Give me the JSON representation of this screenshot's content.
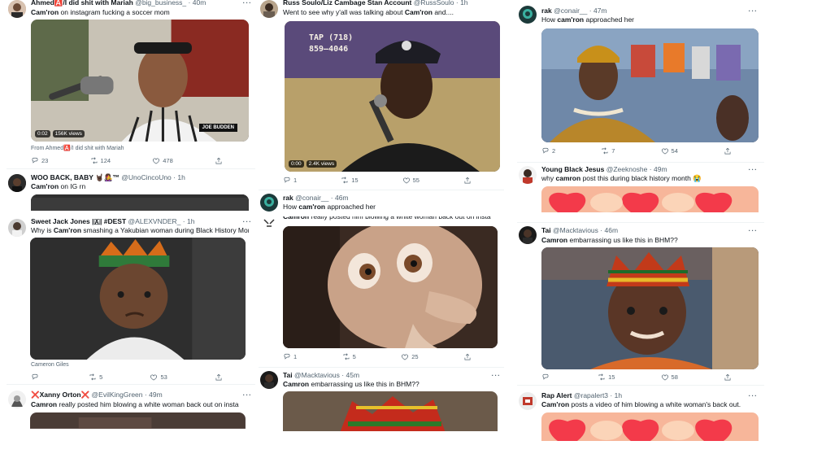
{
  "columns": [
    {
      "tweets": [
        {
          "name": "Ahmed🅰️/I did shit with Mariah",
          "handle": "@big_business_",
          "time": "40m",
          "text": [
            {
              "t": "Cam'ron",
              "b": true
            },
            {
              "t": " on instagram fucking a soccer mom",
              "b": false
            }
          ],
          "video_time": "0:02",
          "views": "156K views",
          "from_label": "From",
          "from_name": "Ahmed🅰️/I did shit with Mariah",
          "replies": "23",
          "retweets": "124",
          "likes": "478",
          "media_badge": "JOE BUDDEN"
        },
        {
          "name": "WOO BACK, BABY 🤘🏿👩‍🎤™",
          "handle": "@UnoCincoUno",
          "time": "1h",
          "text": [
            {
              "t": "Cam'ron",
              "b": true
            },
            {
              "t": " on IG rn",
              "b": false
            }
          ]
        },
        {
          "name": "Sweet Jack Jones |🇦| #DEST",
          "handle": "@ALEXVNDER_",
          "time": "1h",
          "text": [
            {
              "t": "Why is ",
              "b": false
            },
            {
              "t": "Cam'ron",
              "b": true
            },
            {
              "t": " smashing a Yakubian woman during Black History Month???",
              "b": false
            }
          ],
          "credit": "Cameron Giles",
          "replies": "",
          "retweets": "5",
          "likes": "53"
        },
        {
          "name": "❌Xanny Orton❌",
          "handle": "@EvilKingGreen",
          "time": "49m",
          "text": [
            {
              "t": "Camron",
              "b": true
            },
            {
              "t": " really posted him blowing a white woman back out on insta",
              "b": false
            }
          ]
        }
      ]
    },
    {
      "tweets": [
        {
          "name": "Russ Soulo/Liz Cambage Stan Account",
          "handle": "@RussSoulo",
          "time": "1h",
          "text": [
            {
              "t": "Went to see why y'all was talking about ",
              "b": false
            },
            {
              "t": "Cam'ron",
              "b": true
            },
            {
              "t": " and....",
              "b": false
            }
          ],
          "video_time": "0:00",
          "views": "2.4K views",
          "media_caption": "TAP (718)\n859—4046",
          "replies": "1",
          "retweets": "15",
          "likes": "55"
        },
        {
          "name": "rak",
          "handle": "@conair__",
          "time": "46m",
          "text": [
            {
              "t": "How ",
              "b": false
            },
            {
              "t": "cam'ron",
              "b": true
            },
            {
              "t": " approached her",
              "b": false
            }
          ]
        },
        {
          "cut_text": [
            {
              "t": "Camron",
              "b": true
            },
            {
              "t": " really posted him blowing a white woman back out on insta",
              "b": false
            }
          ],
          "replies": "1",
          "retweets": "5",
          "likes": "25"
        },
        {
          "name": "Tai",
          "handle": "@Macktavious",
          "time": "45m",
          "text": [
            {
              "t": "Camron",
              "b": true
            },
            {
              "t": " embarrassing us like this in BHM??",
              "b": false
            }
          ]
        }
      ]
    },
    {
      "tweets": [
        {
          "name": "rak",
          "handle": "@conair__",
          "time": "47m",
          "text": [
            {
              "t": "How ",
              "b": false
            },
            {
              "t": "cam'ron",
              "b": true
            },
            {
              "t": " approached her",
              "b": false
            }
          ],
          "replies": "2",
          "retweets": "7",
          "likes": "54"
        },
        {
          "name": "Young Black Jesus",
          "handle": "@Zeeknoshe",
          "time": "49m",
          "text": [
            {
              "t": "why ",
              "b": false
            },
            {
              "t": "camron",
              "b": true
            },
            {
              "t": " post this during black history month 😭",
              "b": false
            }
          ]
        },
        {
          "name": "Tai",
          "handle": "@Macktavious",
          "time": "46m",
          "text": [
            {
              "t": "Camron",
              "b": true
            },
            {
              "t": " embarrassing us like this in BHM??",
              "b": false
            }
          ],
          "replies": "",
          "retweets": "15",
          "likes": "58"
        },
        {
          "name": "Rap Alert",
          "handle": "@rapalert3",
          "time": "1h",
          "text": [
            {
              "t": "Cam'ron",
              "b": true
            },
            {
              "t": " posts a video of him blowing a white woman's back out.",
              "b": false
            }
          ]
        }
      ]
    }
  ],
  "ui": {
    "more": "···",
    "sep": "·"
  }
}
